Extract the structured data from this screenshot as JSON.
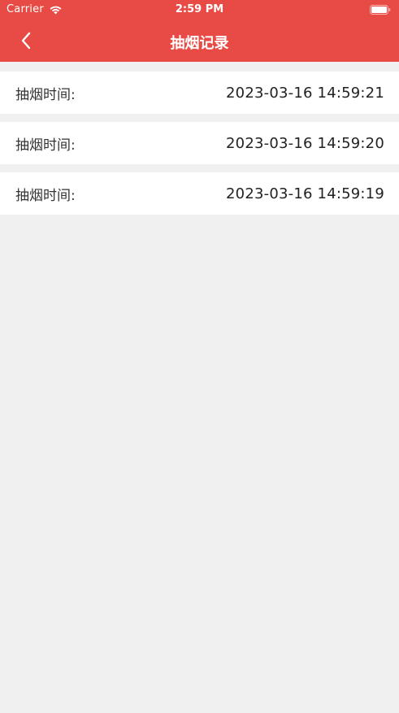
{
  "status_bar": {
    "carrier": "Carrier",
    "time": "2:59 PM",
    "wifi_icon": "wifi-icon",
    "battery_icon": "battery-icon"
  },
  "nav": {
    "title": "抽烟记录",
    "back_icon": "chevron-left-icon"
  },
  "colors": {
    "header_bg": "#e84b45",
    "page_bg": "#f0f0f0",
    "row_bg": "#ffffff"
  },
  "records": [
    {
      "label": "抽烟时间:",
      "value": "2023-03-16 14:59:21"
    },
    {
      "label": "抽烟时间:",
      "value": "2023-03-16 14:59:20"
    },
    {
      "label": "抽烟时间:",
      "value": "2023-03-16 14:59:19"
    }
  ]
}
